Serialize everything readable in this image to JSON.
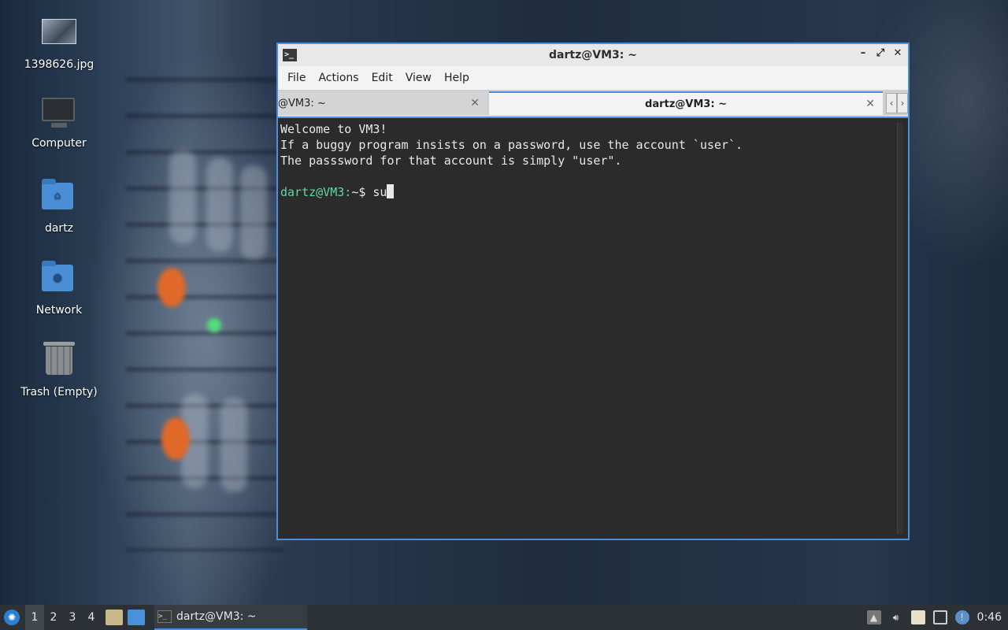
{
  "desktop": {
    "icons": [
      {
        "label": "1398626.jpg",
        "icon": "image-file-icon"
      },
      {
        "label": "Computer",
        "icon": "computer-icon"
      },
      {
        "label": "dartz",
        "icon": "home-folder-icon"
      },
      {
        "label": "Network",
        "icon": "network-folder-icon"
      },
      {
        "label": "Trash (Empty)",
        "icon": "trash-icon"
      }
    ]
  },
  "window": {
    "title": "dartz@VM3: ~",
    "menu": [
      "File",
      "Actions",
      "Edit",
      "View",
      "Help"
    ],
    "tabs": [
      {
        "label": "@VM3: ~",
        "active": false
      },
      {
        "label": "dartz@VM3: ~",
        "active": true
      }
    ],
    "terminal": {
      "lines": [
        "Welcome to VM3!",
        "If a buggy program insists on a password, use the account `user`.",
        "The passsword for that account is simply \"user\"."
      ],
      "prompt": "dartz@VM3:",
      "prompt_suffix": "~$ ",
      "command": "su"
    }
  },
  "taskbar": {
    "desktops": [
      "1",
      "2",
      "3",
      "4"
    ],
    "current_desktop": "1",
    "task_label": "dartz@VM3: ~",
    "clock": "0:46"
  },
  "colors": {
    "accent": "#4a90d9",
    "terminal_bg": "#2b2b2b",
    "prompt": "#5fd7a0"
  }
}
